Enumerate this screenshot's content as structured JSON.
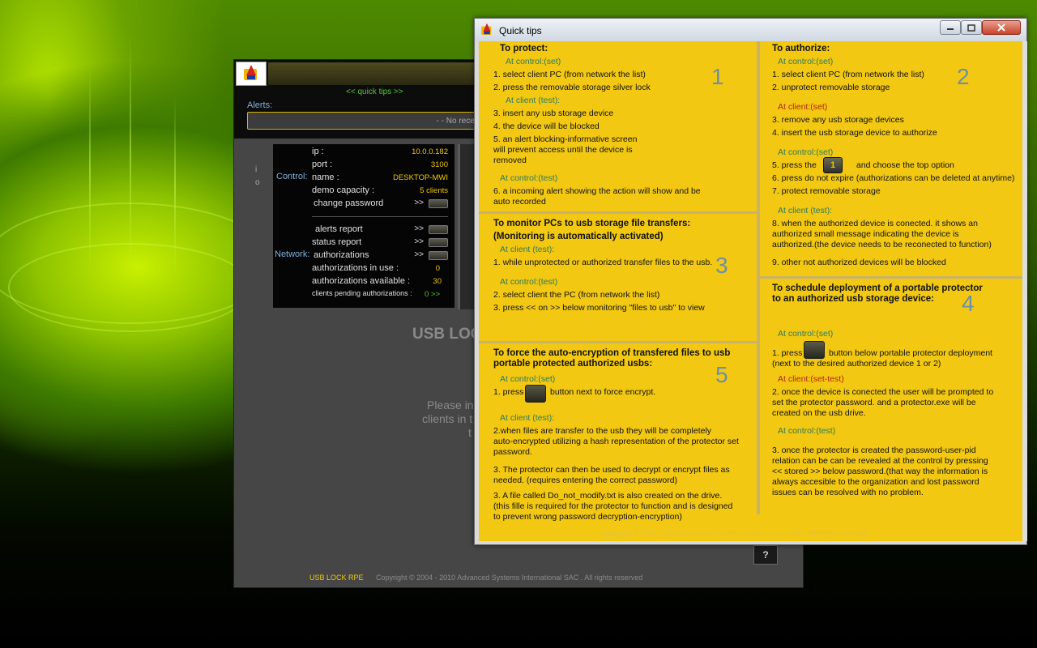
{
  "app": {
    "title": "U",
    "quick_tips_link": "<< quick tips >>",
    "alerts_label": "Alerts:",
    "alerts_text": "- - No recei",
    "side_i": "i",
    "side_o": "o",
    "control_label": "Control:",
    "network_label": "Network:",
    "info": {
      "ip_label": "ip :",
      "ip_value": "10.0.0.182",
      "port_label": "port :",
      "port_value": "3100",
      "name_label": "name :",
      "name_value": "DESKTOP-MWI",
      "capacity_label": "demo capacity :",
      "capacity_value": "5 clients",
      "change_password_label": "change password",
      "alerts_report_label": "alerts report",
      "status_report_label": "status report",
      "authorizations_label": "authorizations",
      "auth_in_use_label": "authorizations in  use :",
      "auth_in_use_value": "0",
      "auth_available_label": "authorizations available :",
      "auth_available_value": "30",
      "pending_label": "clients pending authorizations :",
      "pending_value": "0 >>",
      "arrow": ">>"
    },
    "brand_big": "USB LOC",
    "please_line1": "Please in",
    "please_line2": "clients in t",
    "please_line3": "t",
    "help_button": "?",
    "footer_brand": "USB LOCK RPE",
    "footer_copy": "Copyright © 2004 - 2010  Advanced Systems International SAC . All rights reserved",
    "colors": {
      "accent": "#f0c800",
      "label_blue": "#7fb1e0",
      "link_green": "#54c832"
    }
  },
  "quick_tips": {
    "title": "Quick tips",
    "copyright": "copyright © 2004 - 2010  Advanced Systems International SAC . All rights reserved",
    "protect": {
      "number": "1",
      "heading": "To protect:",
      "l1": "At control:(set)",
      "l2": "1. select client PC (from network the list)",
      "l3": "2. press the removable storage silver lock",
      "l4": "At client (test):",
      "l5": "3. insert any usb storage device",
      "l6": "4. the device will be blocked",
      "l7": "5. an alert blocking-informative screen",
      "l8": "will prevent access until the device is",
      "l9": "removed",
      "l10": "At control:(test)",
      "l11": "6. a incoming alert showing the action will show and be",
      "l12": "auto recorded"
    },
    "authorize": {
      "number": "2",
      "heading": "To authorize:",
      "l1": "At control:(set)",
      "l2": "1. select client PC (from network the list)",
      "l3": "2. unprotect removable storage",
      "l4": "At client:(set)",
      "l5": "3. remove any usb storage devices",
      "l6": "4. insert the usb storage device to authorize",
      "l7": "At control:(set)",
      "l8a": "5. press the",
      "l8btn": "1",
      "l8b": "and choose the top option",
      "l9": "6. press do not expire (authorizations can be deleted at anytime)",
      "l10": "7. protect removable storage",
      "l11": "At client (test):",
      "l12": "8. when the authorized device is conected. it shows an",
      "l13": "authorized small message indicating the device is",
      "l14": "authorized.(the device needs to be reconected to function)",
      "l15": "9. other not authorized devices will be blocked"
    },
    "monitor": {
      "number": "3",
      "heading1": "To monitor PCs to usb storage file transfers:",
      "heading2": "(Monitoring is automatically activated)",
      "l1": "At client (test):",
      "l2": "1. while unprotected or authorized transfer files to the usb.",
      "l3": "At control:(test)",
      "l4": "2. select client the PC (from network the list)",
      "l5": "3. press << on >> below monitoring \"files to usb\" to view"
    },
    "schedule": {
      "number": "4",
      "heading1": "To schedule deployment of a portable protector",
      "heading2": "to an authorized usb storage device:",
      "l1": "At control:(set)",
      "l2a": "1. press",
      "l2b": "button below portable protector deployment",
      "l3": "(next to the desired authorized device 1 or 2)",
      "l4": "At client:(set-test)",
      "l5": "2. once the device is conected the user will be prompted to",
      "l6": "set the protector password. and a protector.exe will be",
      "l7": "created on the usb drive.",
      "l8": "At control:(test)",
      "l9": "3. once the protector is created the password-user-pid",
      "l10": "relation can be can be revealed at the control by pressing",
      "l11": "<< stored >> below password.(that way the information is",
      "l12": "always accesible to the organization and lost password",
      "l13": "issues can be resolved with no problem."
    },
    "encrypt": {
      "number": "5",
      "heading1": "To force the auto-encryption of transfered files to usb",
      "heading2": "portable protected authorized usbs:",
      "l1": "At control:(set)",
      "l2a": "1. press",
      "l2b": "button next to force encrypt.",
      "l3": "At client (test):",
      "l4": "2.when files are transfer to the usb they will be completely",
      "l5": "auto-encrypted utilizing a hash representation of the protector set",
      "l6": "password.",
      "l7": "3. The protector can then be used to decrypt or encrypt files as",
      "l8": "needed. (requires entering the correct password)",
      "l9": "3. A file called Do_not_modify.txt is also created on the drive.",
      "l10": "(this fille is required for the protector to function and is designed",
      "l11": "to prevent wrong password decryption-encryption)"
    },
    "colors": {
      "background": "#f2c812",
      "set_green": "#2f7a5c",
      "client_red": "#b52512",
      "number_blue": "#6c8fab"
    }
  }
}
